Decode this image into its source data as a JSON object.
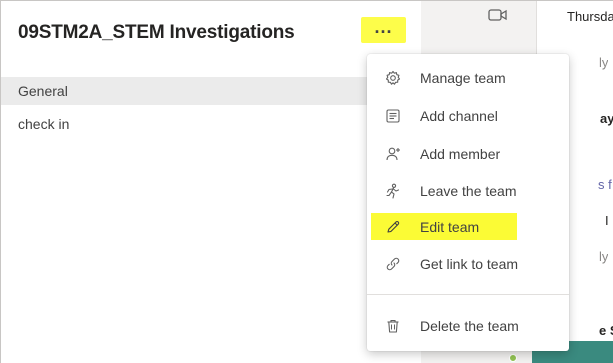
{
  "team": {
    "name": "09STM2A_STEM Investigations",
    "more_label": "..."
  },
  "channels": [
    {
      "label": "General"
    },
    {
      "label": "check in"
    }
  ],
  "background": {
    "day_label": "Thursday",
    "fragment_1": "ly",
    "fragment_2": "ay",
    "fragment_3": "s f",
    "fragment_4": "I",
    "fragment_5": "ly",
    "fragment_6": "e S"
  },
  "menu": {
    "items": [
      {
        "label": "Manage team",
        "icon": "gear-icon"
      },
      {
        "label": "Add channel",
        "icon": "channel-icon"
      },
      {
        "label": "Add member",
        "icon": "add-person-icon"
      },
      {
        "label": "Leave the team",
        "icon": "leave-icon"
      },
      {
        "label": "Edit team",
        "icon": "pencil-icon"
      },
      {
        "label": "Get link to team",
        "icon": "link-icon"
      },
      {
        "label": "Delete the team",
        "icon": "trash-icon"
      }
    ]
  },
  "colors": {
    "highlight": "#fbfb35",
    "selected_channel_bg": "#ebebeb"
  }
}
